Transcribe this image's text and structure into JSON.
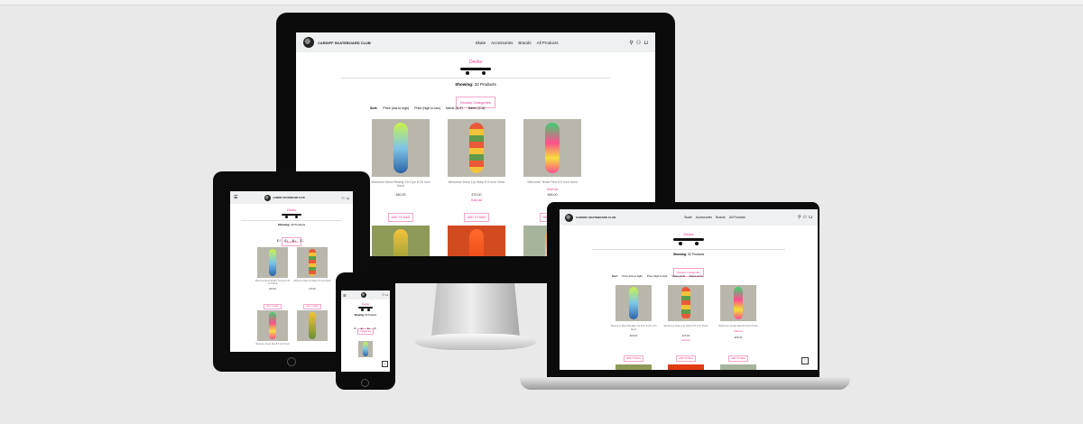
{
  "site": {
    "brand": "CARDIFF SKATEBOARD CLUB",
    "nav_links": [
      "Skate",
      "Accessories",
      "Brands",
      "All Products"
    ],
    "icons": [
      "search-icon",
      "user-icon",
      "bag-icon"
    ],
    "category": "Decks",
    "showing_label": "Showing:",
    "showing_value": "32 Products",
    "browse_button": "Browse Categories",
    "categories_button": "Categories",
    "sort_label": "Sort:",
    "sort_options": [
      "Price (low to high)",
      "Price (high to low)",
      "Name (A-Z)",
      "Name (Z-A)"
    ],
    "sort_short": [
      "£↑",
      "£↓",
      "A↓",
      "Z↓"
    ],
    "add_button": "ADD TO BAG",
    "back_to_top": "↑"
  },
  "products": [
    {
      "name": "Welcome Bend Reality Tie Dye 8.25 Inch Deck",
      "price": "£60.00",
      "sale": "",
      "colors": [
        "#c9f24a",
        "#7ec6e8",
        "#2c63a8"
      ]
    },
    {
      "name": "Welcome Dave Lip Warp 8.5 Inch Deck",
      "price": "£70.00",
      "sale": "Sold out",
      "colors": [
        "#e85a3a",
        "#f3c23b",
        "#5f9b4a"
      ]
    },
    {
      "name": "Welcome Texas Red 8.5 Inch Deck",
      "price": "£65.00",
      "sale": "Sold out",
      "colors": [
        "#ff4f8f",
        "#3bd06f",
        "#f4df3b"
      ]
    }
  ]
}
